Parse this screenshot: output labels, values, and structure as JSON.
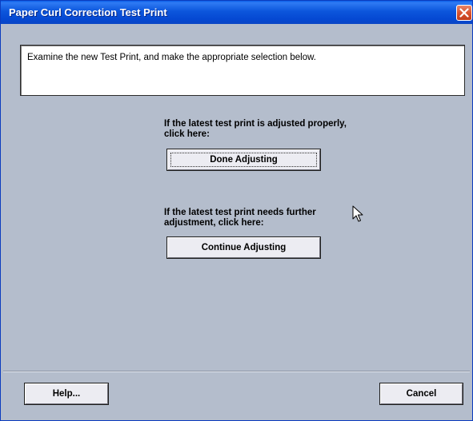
{
  "window": {
    "title": "Paper Curl Correction Test Print",
    "close_icon": "close-icon"
  },
  "message": {
    "text": "Examine the new Test Print, and make the appropriate selection below."
  },
  "done_section": {
    "prompt_line1": "If the latest test print is adjusted properly,",
    "prompt_line2": "click here:",
    "button_label": "Done Adjusting"
  },
  "continue_section": {
    "prompt_line1": "If the latest test print needs further",
    "prompt_line2": "adjustment, click here:",
    "button_label": "Continue Adjusting"
  },
  "footer": {
    "help_label": "Help...",
    "cancel_label": "Cancel"
  },
  "colors": {
    "titlebar": "#0c56dc",
    "dialog_background": "#b4bdcc",
    "button_face": "#ececf2",
    "close_button": "#d9532f"
  },
  "icons": {
    "close": "close-icon",
    "pointer": "mouse-pointer-icon"
  }
}
